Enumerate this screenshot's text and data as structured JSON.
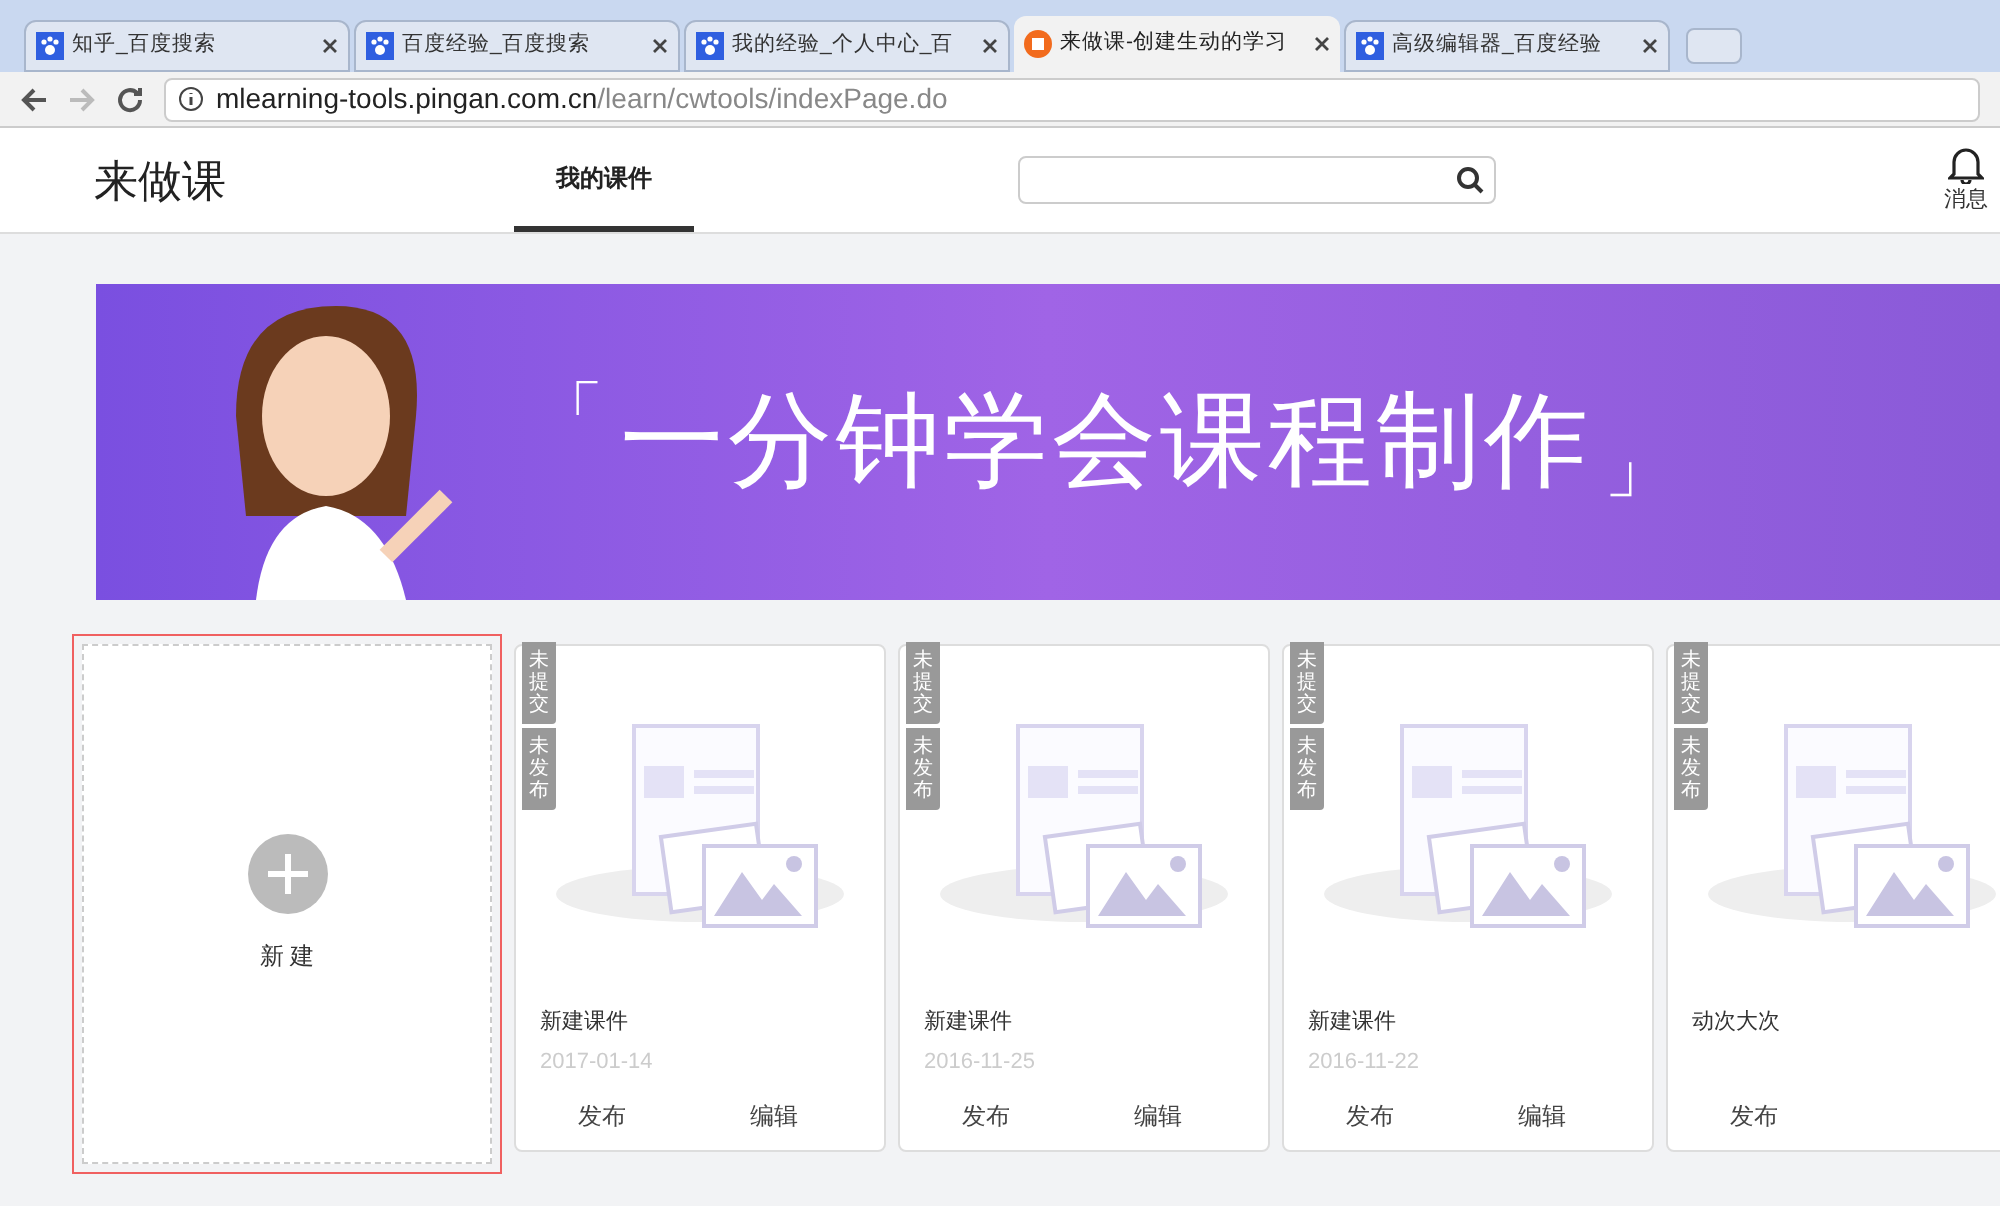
{
  "browser": {
    "tabs": [
      {
        "title": "知乎_百度搜索",
        "kind": "search",
        "selected": false
      },
      {
        "title": "百度经验_百度搜索",
        "kind": "search",
        "selected": false
      },
      {
        "title": "我的经验_个人中心_百",
        "kind": "search",
        "selected": false
      },
      {
        "title": "来做课-创建生动的学习",
        "kind": "course",
        "selected": true
      },
      {
        "title": "高级编辑器_百度经验",
        "kind": "search",
        "selected": false
      }
    ],
    "url_host": "mlearning-tools.pingan.com.cn",
    "url_path": "/learn/cwtools/indexPage.do"
  },
  "header": {
    "logo": "来做课",
    "nav": [
      {
        "label": "我的课件",
        "selected": true
      }
    ],
    "notifications_label": "消息"
  },
  "banner": {
    "bracket_open": "「",
    "headline": "一分钟学会课程制作",
    "bracket_close": "」"
  },
  "new_course": {
    "label": "新 建"
  },
  "courses": [
    {
      "badges": [
        "未提交",
        "未发布"
      ],
      "title": "新建课件",
      "date": "2017-01-14",
      "actions": [
        "发布",
        "编辑"
      ]
    },
    {
      "badges": [
        "未提交",
        "未发布"
      ],
      "title": "新建课件",
      "date": "2016-11-25",
      "actions": [
        "发布",
        "编辑"
      ]
    },
    {
      "badges": [
        "未提交",
        "未发布"
      ],
      "title": "新建课件",
      "date": "2016-11-22",
      "actions": [
        "发布",
        "编辑"
      ]
    },
    {
      "badges": [
        "未提交",
        "未发布"
      ],
      "title": "动次大次",
      "actions": [
        "发布"
      ]
    }
  ]
}
